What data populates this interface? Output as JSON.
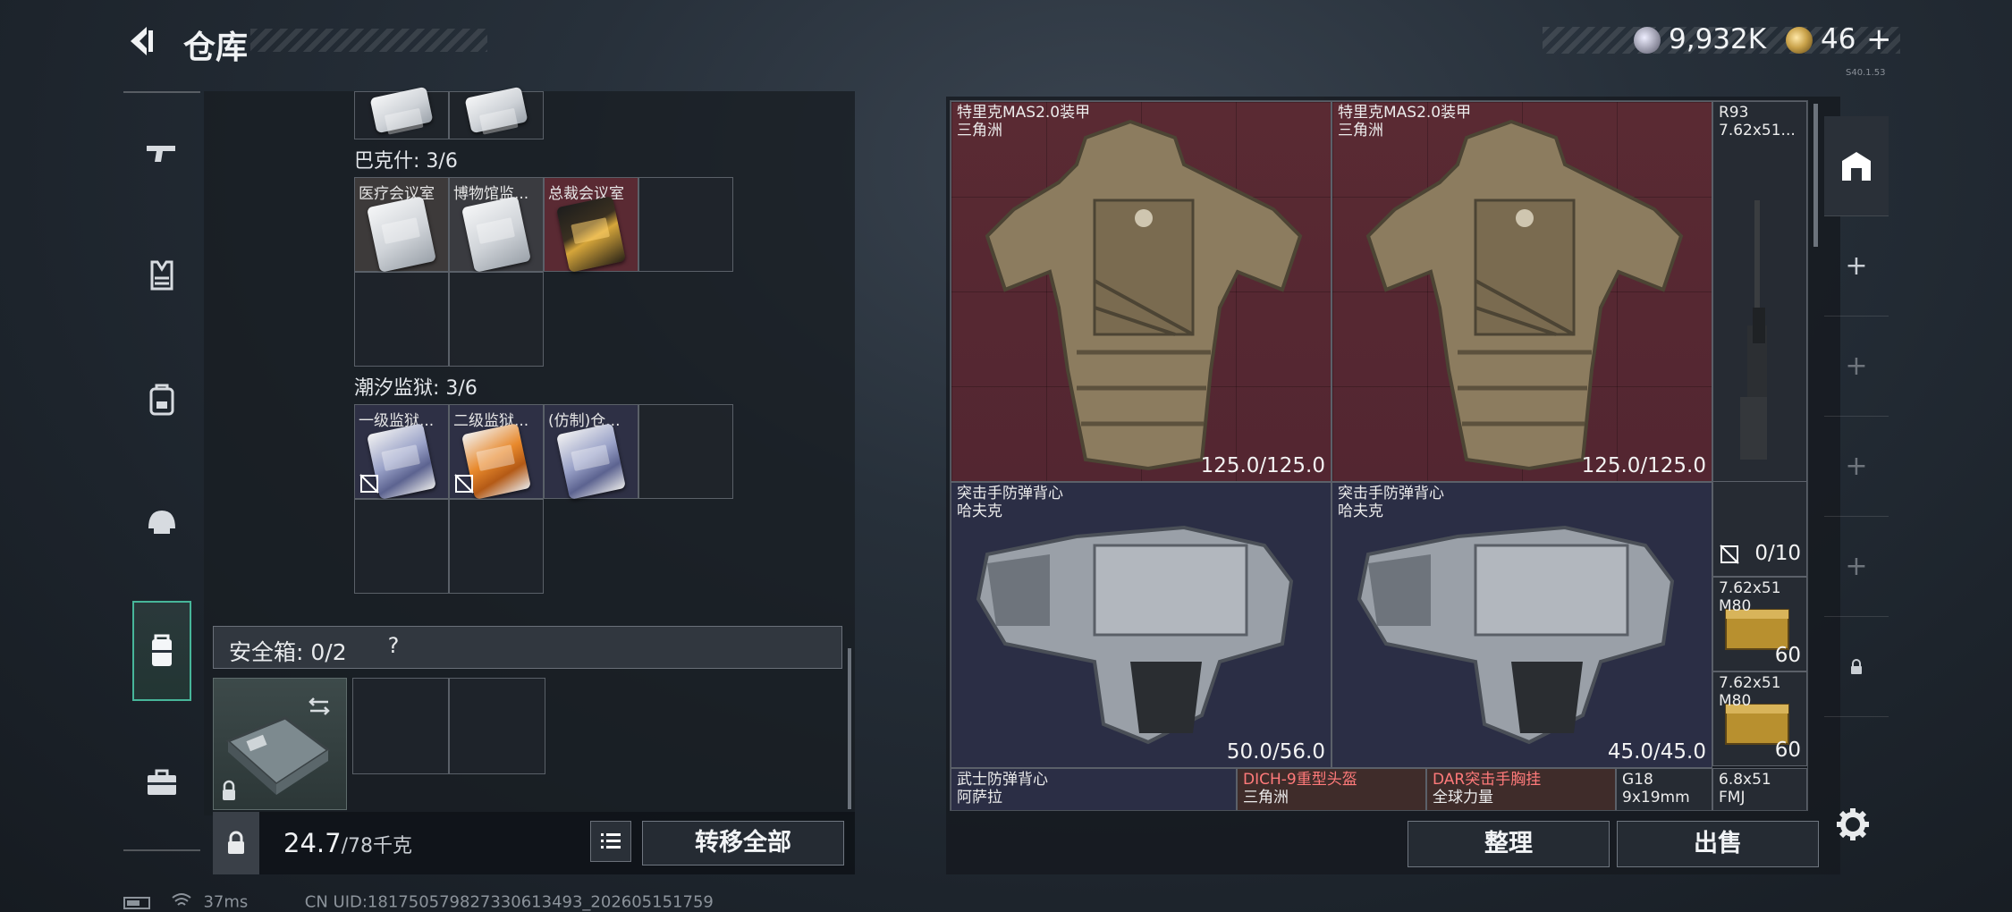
{
  "header": {
    "title": "仓库",
    "currency1": "9,932K",
    "currency2": "46",
    "currency2_plus": "+",
    "version": "S40.1.53"
  },
  "left_nav": {
    "items": [
      "weapon",
      "armor",
      "backpack",
      "helmet",
      "safe-case",
      "toolbox"
    ],
    "selected": "safe-case"
  },
  "left": {
    "top_section_partial": true,
    "sections": [
      {
        "title": "巴克什: 3/6",
        "cards": [
          {
            "label": "医疗会议室",
            "style": "white"
          },
          {
            "label": "博物馆监...",
            "style": "white"
          },
          {
            "label": "总裁会议室",
            "style": "gold"
          }
        ]
      },
      {
        "title": "潮汐监狱: 3/6",
        "cards": [
          {
            "label": "一级监狱...",
            "style": "silver"
          },
          {
            "label": "二级监狱...",
            "style": "orange"
          },
          {
            "label": "(仿制)仓...",
            "style": "silver"
          }
        ]
      }
    ],
    "safe": {
      "label": "安全箱: 0/2",
      "help": "?"
    },
    "weight": {
      "current": "24.7",
      "max": "/78千克"
    },
    "transfer_label": "转移全部"
  },
  "right": {
    "items": [
      {
        "name": "特里克MAS2.0装甲",
        "sub": "三角洲",
        "value": "125.0/125.0",
        "color": "red"
      },
      {
        "name": "特里克MAS2.0装甲",
        "sub": "三角洲",
        "value": "125.0/125.0",
        "color": "red"
      },
      {
        "name": "R93",
        "sub": "7.62x51...",
        "value": "",
        "color": "dark"
      },
      {
        "name": "突击手防弹背心",
        "sub": "哈夫克",
        "value": "50.0/56.0",
        "color": "blue"
      },
      {
        "name": "突击手防弹背心",
        "sub": "哈夫克",
        "value": "45.0/45.0",
        "color": "blue"
      },
      {
        "name": "",
        "sub": "",
        "value": "0/10",
        "color": "dark"
      },
      {
        "name": "7.62x51",
        "sub": "M80",
        "value": "60",
        "color": "dark"
      },
      {
        "name": "7.62x51",
        "sub": "M80",
        "value": "60",
        "color": "dark"
      },
      {
        "name": "武士防弹背心",
        "sub": "阿萨拉",
        "value": "",
        "color": "blue"
      },
      {
        "name": "DICH-9重型头盔",
        "sub": "三角洲",
        "value": "",
        "color": "brown"
      },
      {
        "name": "DAR突击手胸挂",
        "sub": "全球力量",
        "value": "",
        "color": "brown"
      },
      {
        "name": "G18",
        "sub": "9x19mm",
        "value": "",
        "color": "dark"
      },
      {
        "name": "6.8x51",
        "sub": "FMJ",
        "value": "",
        "color": "dark"
      }
    ],
    "sort_label": "整理",
    "sell_label": "出售"
  },
  "status": {
    "ping": "37ms",
    "uid": "CN UID:181750579827330613493_202605151759"
  }
}
